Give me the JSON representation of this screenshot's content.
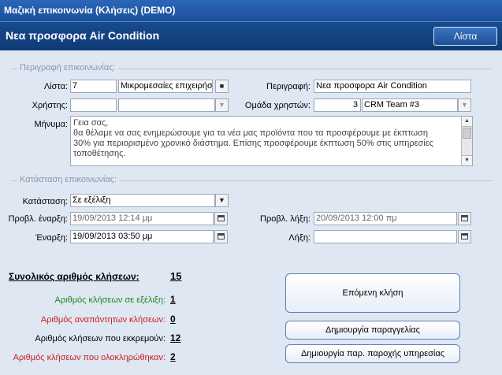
{
  "window": {
    "title": "Μαζική επικοινωνία (Κλήσεις) (DEMO)"
  },
  "header": {
    "title": "Νεα προσφορα Air Condition",
    "list_button": "Λίστα"
  },
  "description_group": {
    "title": "Περιγραφή επικοινωνίας:",
    "list_label": "Λίστα:",
    "list_id": "7",
    "list_name": "Μικρομεσαίες επιχειρήσ",
    "list_button_glyph": "■",
    "description_label": "Περιγραφή:",
    "description_value": "Νεα προσφορα Air Condition",
    "user_label": "Χρήστης:",
    "user_id": "",
    "user_name": "",
    "user_group_label": "Ομάδα χρηστών:",
    "user_group_id": "3",
    "user_group_name": "CRM Team #3",
    "message_label": "Μήνυμα:",
    "message_lines": [
      "Γεια σας,",
      "θα θέλαμε να σας ενημερώσουμε για τα νέα μας προϊόντα που τα προσφέρουμε με έκπτωση",
      "30% για περιορισμένο χρονικό διάστημα. Επίσης προσφέρουμε έκπτωση 50% στις υπηρεσίες",
      "τοποθέτησης."
    ]
  },
  "status_group": {
    "title": "Κατάσταση επικοινωνίας:",
    "status_label": "Κατάσταση:",
    "status_value": "Σε εξέλιξη",
    "planned_start_label": "Προβλ. έναρξη:",
    "planned_start_value": "19/09/2013 12:14 μμ",
    "planned_end_label": "Προβλ. λήξη:",
    "planned_end_value": "20/09/2013 12:00 πμ",
    "start_label": "Έναρξη:",
    "start_value": "19/09/2013 03:50 μμ",
    "end_label": "Λήξη:",
    "end_value": ""
  },
  "stats": {
    "total_label": "Συνολικός αριθμός κλήσεων:",
    "total_value": "15",
    "rows": [
      {
        "label": "Αριθμός κλήσεων σε εξέλιξη:",
        "value": "1",
        "color": "#1a8a1a"
      },
      {
        "label": "Αριθμός αναπάντητων κλήσεων:",
        "value": "0",
        "color": "#c81e1e"
      },
      {
        "label": "Αριθμός κλήσεων που εκκρεμούν:",
        "value": "12",
        "color": "#000000"
      },
      {
        "label": "Αριθμός κλήσεων που ολοκληρώθηκαν:",
        "value": "2",
        "color": "#c81e1e"
      }
    ]
  },
  "actions": {
    "next_call": "Επόμενη κλήση",
    "create_order": "Δημιουργία παραγγελίας",
    "create_service": "Δημιουργία παρ. παροχής υπηρεσίας"
  },
  "icons": {
    "dropdown": "▼",
    "scroll_up": "▲",
    "scroll_down": "▼",
    "calendar": "calendar-icon"
  }
}
